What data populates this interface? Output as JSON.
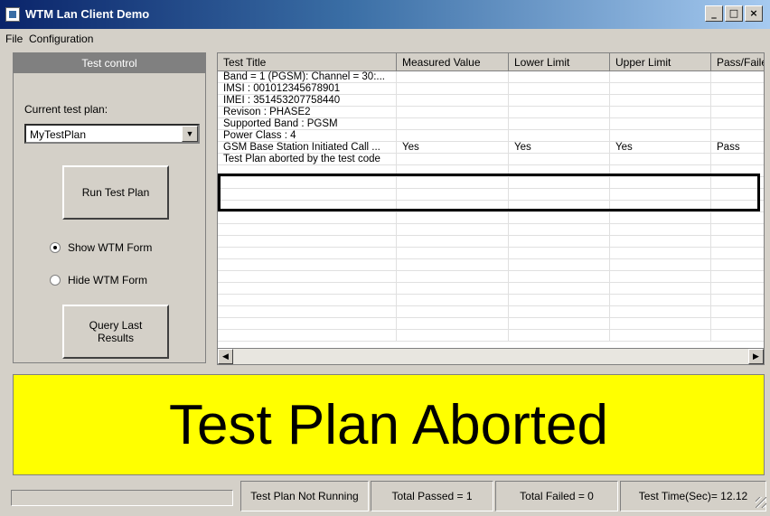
{
  "window": {
    "title": "WTM Lan Client Demo",
    "min": "_",
    "max": "□",
    "close": "×"
  },
  "menu": {
    "file": "File",
    "configuration": "Configuration"
  },
  "left": {
    "header": "Test control",
    "plan_label": "Current test plan:",
    "plan_value": "MyTestPlan",
    "run_button": "Run Test Plan",
    "radio_show": "Show WTM Form",
    "radio_hide": "Hide WTM Form",
    "query_button_line1": "Query Last",
    "query_button_line2": "Results"
  },
  "grid": {
    "columns": [
      "Test Title",
      "Measured Value",
      "Lower Limit",
      "Upper Limit",
      "Pass/Faile"
    ],
    "rows": [
      [
        "Band = 1 (PGSM): Channel = 30:...",
        "",
        "",
        "",
        ""
      ],
      [
        "IMSI : 001012345678901",
        "",
        "",
        "",
        ""
      ],
      [
        "IMEI : 351453207758440",
        "",
        "",
        "",
        ""
      ],
      [
        "Revison : PHASE2",
        "",
        "",
        "",
        ""
      ],
      [
        "Supported Band : PGSM",
        "",
        "",
        "",
        ""
      ],
      [
        "Power Class : 4",
        "",
        "",
        "",
        ""
      ],
      [
        "GSM Base Station Initiated Call ...",
        "Yes",
        "Yes",
        "Yes",
        "Pass"
      ],
      [
        "Test Plan aborted by the test code",
        "",
        "",
        "",
        ""
      ]
    ]
  },
  "banner": {
    "text": "Test Plan Aborted",
    "color": "#ffff00"
  },
  "status": {
    "running": "Test Plan Not Running",
    "passed": "Total Passed = 1",
    "failed": "Total Failed = 0",
    "time": "Test Time(Sec)= 12.12"
  }
}
